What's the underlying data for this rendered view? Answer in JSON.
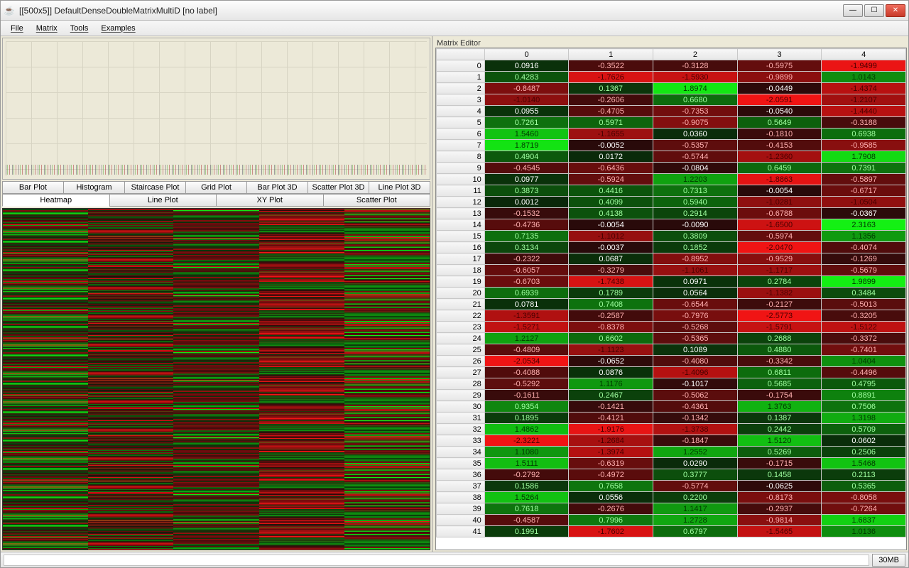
{
  "window": {
    "title": "[[500x5]] DefaultDenseDoubleMatrixMultiD [no label]"
  },
  "menu": [
    "File",
    "Matrix",
    "Tools",
    "Examples"
  ],
  "tabs_row1": [
    "Bar Plot",
    "Histogram",
    "Staircase Plot",
    "Grid Plot",
    "Bar Plot 3D",
    "Scatter Plot 3D",
    "Line Plot 3D"
  ],
  "tabs_row2": [
    "Heatmap",
    "Line Plot",
    "XY Plot",
    "Scatter Plot"
  ],
  "active_tab": "Heatmap",
  "editor_label": "Matrix Editor",
  "status": {
    "mem": "30MB"
  },
  "chart_data": {
    "type": "heatmap",
    "title": "",
    "column_headers": [
      "0",
      "1",
      "2",
      "3",
      "4"
    ],
    "rows": [
      {
        "i": 0,
        "v": [
          0.0916,
          -0.3522,
          -0.3128,
          -0.5975,
          -1.9499
        ]
      },
      {
        "i": 1,
        "v": [
          0.4283,
          -1.7626,
          -1.593,
          -0.9899,
          1.0143
        ]
      },
      {
        "i": 2,
        "v": [
          -0.8487,
          0.1367,
          1.8974,
          -0.0449,
          -1.4374
        ]
      },
      {
        "i": 3,
        "v": [
          -1.014,
          -0.2606,
          0.668,
          -2.0591,
          -1.2107
        ]
      },
      {
        "i": 4,
        "v": [
          0.0955,
          -0.4705,
          -0.7353,
          -0.054,
          -1.444
        ]
      },
      {
        "i": 5,
        "v": [
          0.7261,
          0.5971,
          -0.9075,
          0.5649,
          -0.3188
        ]
      },
      {
        "i": 6,
        "v": [
          1.546,
          -1.1655,
          0.036,
          -0.181,
          0.6938
        ]
      },
      {
        "i": 7,
        "v": [
          1.8719,
          -0.0052,
          -0.5357,
          -0.4153,
          -0.9585
        ]
      },
      {
        "i": 8,
        "v": [
          0.4904,
          0.0172,
          -0.5744,
          -1.236,
          1.7908
        ]
      },
      {
        "i": 9,
        "v": [
          -0.4545,
          -0.6436,
          -0.0804,
          0.6459,
          0.7391
        ]
      },
      {
        "i": 10,
        "v": [
          0.0977,
          -0.5924,
          1.2203,
          -1.8863,
          -0.5897
        ]
      },
      {
        "i": 11,
        "v": [
          0.3873,
          0.4416,
          0.7313,
          -0.0054,
          -0.6717
        ]
      },
      {
        "i": 12,
        "v": [
          0.0012,
          0.4099,
          0.594,
          -1.0281,
          -1.0504
        ]
      },
      {
        "i": 13,
        "v": [
          -0.1532,
          0.4138,
          0.2914,
          -0.6788,
          -0.0367
        ]
      },
      {
        "i": 14,
        "v": [
          -0.4736,
          -0.0054,
          -0.009,
          -1.65,
          2.3163
        ]
      },
      {
        "i": 15,
        "v": [
          0.7135,
          -1.1012,
          0.3809,
          -0.5974,
          1.1356
        ]
      },
      {
        "i": 16,
        "v": [
          0.3134,
          -0.0037,
          0.1852,
          -2.047,
          -0.4074
        ]
      },
      {
        "i": 17,
        "v": [
          -0.2322,
          0.0687,
          -0.8952,
          -0.9529,
          -0.1269
        ]
      },
      {
        "i": 18,
        "v": [
          -0.6057,
          -0.3279,
          -1.1061,
          -1.1717,
          -0.5679
        ]
      },
      {
        "i": 19,
        "v": [
          -0.6703,
          -1.7438,
          0.0971,
          0.2784,
          1.9899
        ]
      },
      {
        "i": 20,
        "v": [
          0.6939,
          0.1789,
          0.0564,
          -1.1382,
          0.3484
        ]
      },
      {
        "i": 21,
        "v": [
          0.0781,
          0.7408,
          -0.6544,
          -0.2127,
          -0.5013
        ]
      },
      {
        "i": 22,
        "v": [
          -1.3591,
          -0.2587,
          -0.7976,
          -2.5773,
          -0.3205
        ]
      },
      {
        "i": 23,
        "v": [
          -1.5271,
          -0.8378,
          -0.5268,
          -1.5791,
          -1.5122
        ]
      },
      {
        "i": 24,
        "v": [
          1.2127,
          0.6602,
          -0.5365,
          0.2688,
          -0.3372
        ]
      },
      {
        "i": 25,
        "v": [
          -0.4809,
          -1.1123,
          0.1089,
          0.488,
          -0.7401
        ]
      },
      {
        "i": 26,
        "v": [
          -2.0534,
          -0.0652,
          -0.408,
          -0.3342,
          1.0404
        ]
      },
      {
        "i": 27,
        "v": [
          -0.4088,
          0.0876,
          -1.4096,
          0.6811,
          -0.4496
        ]
      },
      {
        "i": 28,
        "v": [
          -0.5292,
          1.1176,
          -0.1017,
          0.5685,
          0.4795
        ]
      },
      {
        "i": 29,
        "v": [
          -0.1611,
          0.2467,
          -0.5062,
          -0.1754,
          0.8891
        ]
      },
      {
        "i": 30,
        "v": [
          0.9354,
          -0.1421,
          -0.4361,
          1.3763,
          0.7506
        ]
      },
      {
        "i": 31,
        "v": [
          0.1895,
          -0.4121,
          -0.1342,
          0.1387,
          1.3198
        ]
      },
      {
        "i": 32,
        "v": [
          1.4862,
          -1.9176,
          -1.3738,
          0.2442,
          0.5709
        ]
      },
      {
        "i": 33,
        "v": [
          -2.3221,
          -1.2684,
          -0.1847,
          1.512,
          0.0602
        ]
      },
      {
        "i": 34,
        "v": [
          1.108,
          -1.3974,
          1.2552,
          0.5269,
          0.2506
        ]
      },
      {
        "i": 35,
        "v": [
          1.5111,
          -0.6319,
          0.029,
          -0.1715,
          1.5468
        ]
      },
      {
        "i": 36,
        "v": [
          -0.2792,
          -0.4972,
          0.3777,
          0.1458,
          0.2113
        ]
      },
      {
        "i": 37,
        "v": [
          0.1586,
          0.7658,
          -0.5774,
          -0.0625,
          0.5365
        ]
      },
      {
        "i": 38,
        "v": [
          1.5264,
          0.0556,
          0.22,
          -0.8173,
          -0.8058
        ]
      },
      {
        "i": 39,
        "v": [
          0.7618,
          -0.2676,
          1.1417,
          -0.2937,
          -0.7264
        ]
      },
      {
        "i": 40,
        "v": [
          -0.4587,
          0.7996,
          1.2728,
          -0.9814,
          1.6837
        ]
      },
      {
        "i": 41,
        "v": [
          0.1991,
          -1.7602,
          0.6797,
          -1.5465,
          1.0136
        ]
      }
    ],
    "value_range": [
      -2.6,
      2.4
    ]
  }
}
